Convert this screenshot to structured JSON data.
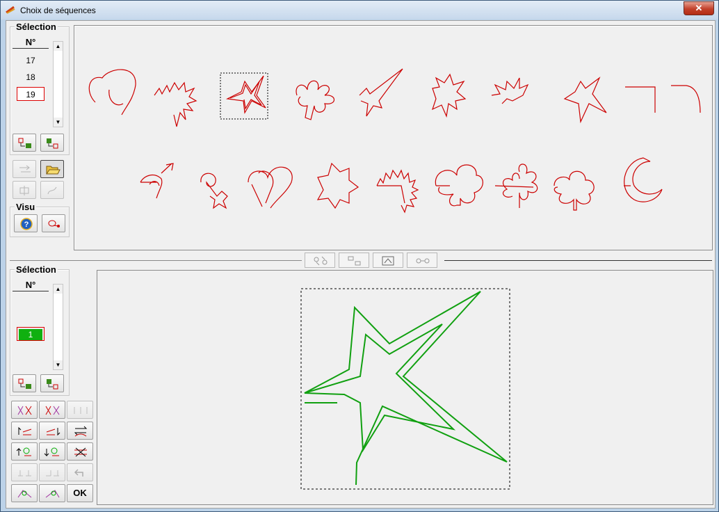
{
  "window": {
    "title": "Choix de séquences",
    "close_label": "✕"
  },
  "top_panel": {
    "group_title": "Sélection",
    "list_header": "N°",
    "items": [
      "17",
      "18",
      "19"
    ],
    "selected_item": "19",
    "visu_title": "Visu"
  },
  "bottom_panel": {
    "group_title": "Sélection",
    "list_header": "N°",
    "selected_item": "1",
    "ok_label": "OK"
  },
  "library_shapes": [
    "heart-shape",
    "burst-shape",
    "star-shape",
    "flower-shape",
    "comet-shape",
    "starburst-shape",
    "splash-shape",
    "star-outline-shape",
    "corner-shape",
    "curve-shape",
    "arrow-curve-shape",
    "gender-symbol-shape",
    "double-heart-shape",
    "asterisk-shape",
    "sawtooth-shape",
    "clover-shape",
    "daisy-shape",
    "flower-outline-shape",
    "crescent-shape"
  ],
  "colors": {
    "library_stroke": "#cc0000",
    "preview_stroke": "#10a010",
    "selection_fill": "#10b010"
  }
}
